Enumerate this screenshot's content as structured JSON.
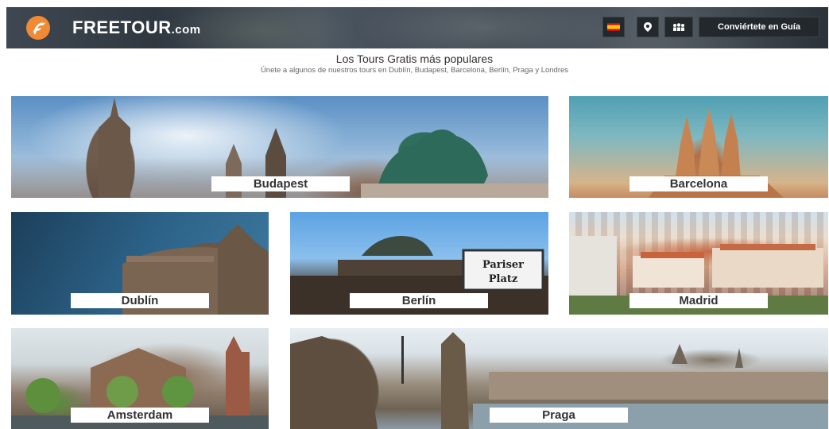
{
  "header": {
    "brand": "FREETOUR",
    "brand_suffix": ".com",
    "flag_icon": "spain-flag-icon",
    "location_icon": "map-pin-icon",
    "group_icon": "group-icon",
    "guide_button": "Conviértete en Guía",
    "accent": "#f08a34"
  },
  "intro": {
    "title": "Los Tours Gratis más populares",
    "subtitle": "Únete a algunos de nuestros tours en Dublín, Budapest, Barcelona, Berlín, Praga y Londres"
  },
  "cities": [
    {
      "label": "Budapest"
    },
    {
      "label": "Barcelona"
    },
    {
      "label": "Dublín"
    },
    {
      "label": "Berlín"
    },
    {
      "label": "Madrid"
    },
    {
      "label": "Amsterdam"
    },
    {
      "label": "Praga"
    }
  ],
  "berlin_sign": {
    "line1": "Pariser",
    "line2": "Platz"
  }
}
